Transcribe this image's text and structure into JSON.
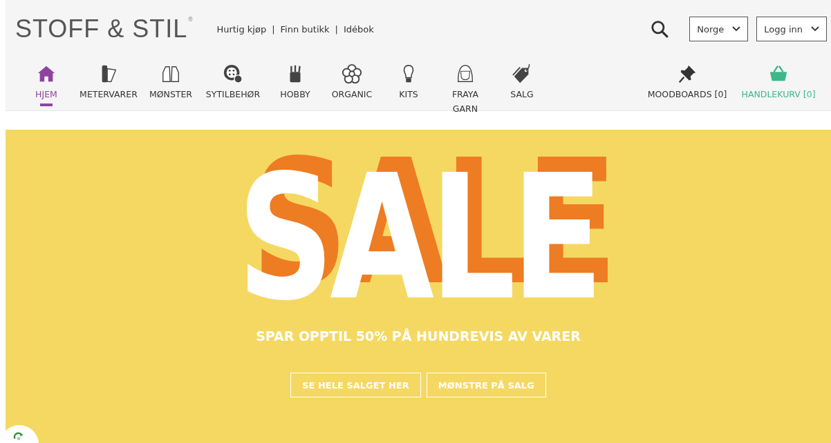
{
  "logo": {
    "text": "STOFF & STIL",
    "mark": "®"
  },
  "top_links": [
    "Hurtig kjøp",
    "Finn butikk",
    "Idébok"
  ],
  "top_separator": "|",
  "country_select": {
    "value": "Norge"
  },
  "login_select": {
    "value": "Logg inn"
  },
  "nav": [
    {
      "label": "HJEM",
      "selected": true
    },
    {
      "label": "METERVARER",
      "selected": false
    },
    {
      "label": "MØNSTER",
      "selected": false
    },
    {
      "label": "SYTILBEHØR",
      "selected": false
    },
    {
      "label": "HOBBY",
      "selected": false
    },
    {
      "label": "ORGANIC",
      "selected": false
    },
    {
      "label": "KITS",
      "selected": false
    },
    {
      "label": "FRAYA GARN",
      "selected": false
    },
    {
      "label": "SALG",
      "selected": false
    }
  ],
  "right_nav": [
    {
      "label": "MOODBOARDS [0]",
      "kind": "moodboards"
    },
    {
      "label": "HANDLEKURV [0]",
      "kind": "cart"
    }
  ],
  "banner": {
    "headline": "SALE",
    "subline": "SPAR OPPTIL 50% PÅ HUNDREVIS AV VARER",
    "buttons": [
      "SE HELE SALGET HER",
      "MØNSTRE PÅ SALG"
    ]
  }
}
